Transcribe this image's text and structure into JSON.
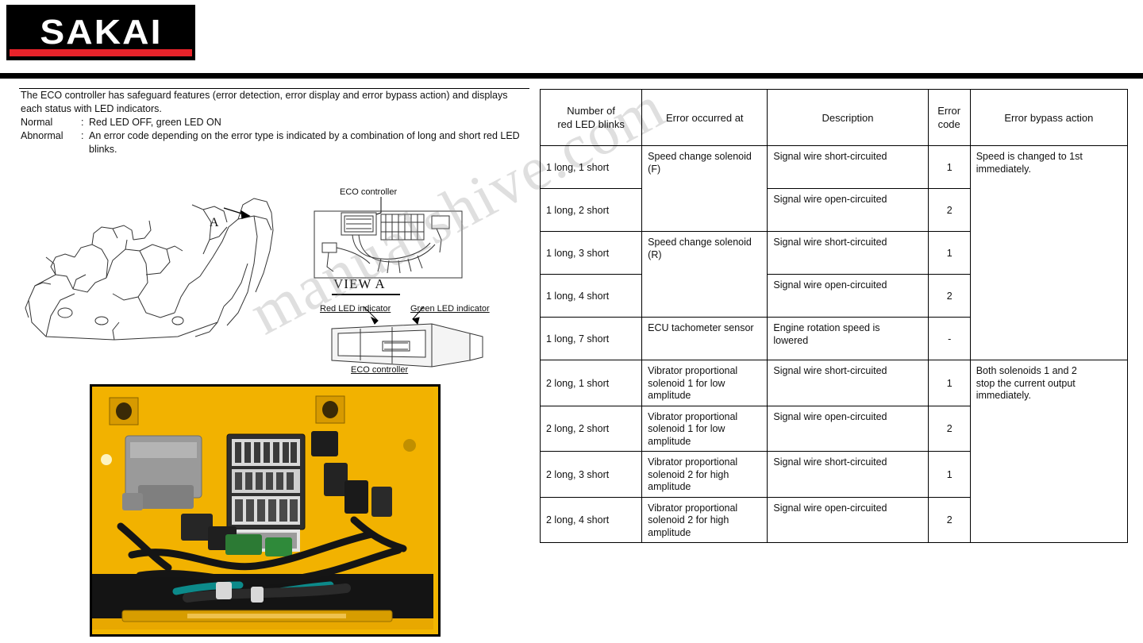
{
  "brand": {
    "name": "SAKAI",
    "accent_color": "#e8232a"
  },
  "intro": {
    "paragraph": "The ECO controller has safeguard features (error detection, error display and error bypass action) and displays each status with LED indicators.",
    "rows": [
      {
        "key": "Normal",
        "value": "Red LED OFF, green LED ON"
      },
      {
        "key": "Abnormal",
        "value": "An error code depending on the error type is indicated by a combination of long and short red LED",
        "cont": "blinks."
      }
    ]
  },
  "drawing": {
    "callout_a": "A",
    "eco_controller_label": "ECO controller",
    "view_a_label": "VIEW A",
    "red_led_label": "Red LED indicator",
    "green_led_label": "Green LED indicator",
    "eco_controller_label2": "ECO controller"
  },
  "watermark": "manualshive.com",
  "table": {
    "headers": [
      "Number of\nred LED blinks",
      "Error occurred at",
      "Description",
      "Error\ncode",
      "Error bypass action"
    ],
    "header_lines": {
      "h1a": "Number of",
      "h1b": "red LED blinks",
      "h2": "Error occurred at",
      "h3": "Description",
      "h4a": "Error",
      "h4b": "code",
      "h5": "Error bypass action"
    },
    "rows": [
      {
        "blinks": "1 long, 1 short",
        "error_at": "Speed change solenoid\n(F)",
        "description": "Signal wire short-circuited",
        "code": "1",
        "bypass": "Speed is changed to 1st\nimmediately."
      },
      {
        "blinks": "1 long, 2 short",
        "error_at": "",
        "description": "Signal wire open-circuited",
        "code": "2",
        "bypass": ""
      },
      {
        "blinks": "1 long, 3 short",
        "error_at": "Speed change solenoid\n(R)",
        "description": "Signal wire short-circuited",
        "code": "1",
        "bypass": ""
      },
      {
        "blinks": "1 long, 4 short",
        "error_at": "",
        "description": "Signal wire open-circuited",
        "code": "2",
        "bypass": ""
      },
      {
        "blinks": "1 long, 7 short",
        "error_at": "ECU tachometer sensor",
        "description": "Engine rotation speed is\nlowered",
        "code": "-",
        "bypass": ""
      },
      {
        "blinks": "2 long, 1 short",
        "error_at": "Vibrator proportional\nsolenoid 1 for low\namplitude",
        "description": "Signal wire short-circuited",
        "code": "1",
        "bypass": "Both solenoids 1 and 2\nstop the current output\nimmediately."
      },
      {
        "blinks": "2 long, 2 short",
        "error_at": "Vibrator proportional\nsolenoid 1 for low\namplitude",
        "description": "Signal wire open-circuited",
        "code": "2",
        "bypass": ""
      },
      {
        "blinks": "2 long, 3 short",
        "error_at": "Vibrator proportional\nsolenoid 2 for high\namplitude",
        "description": "Signal wire short-circuited",
        "code": "1",
        "bypass": ""
      },
      {
        "blinks": "2 long, 4 short",
        "error_at": "Vibrator proportional\nsolenoid 2 for high\namplitude",
        "description": "Signal wire open-circuited",
        "code": "2",
        "bypass": ""
      }
    ]
  }
}
